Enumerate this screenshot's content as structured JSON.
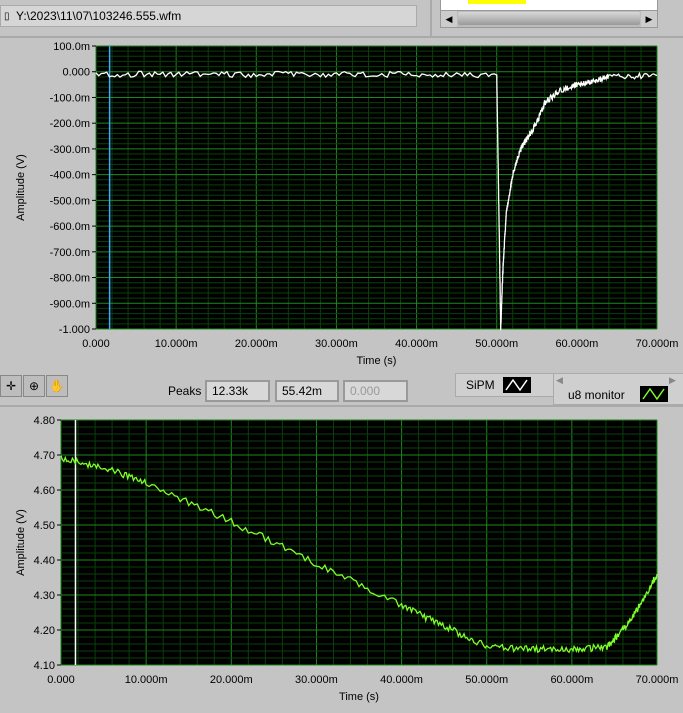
{
  "file_path": "Y:\\2023\\11\\07\\103246.555.wfm",
  "toolbar": {
    "cursor_tool": "cursor-move-icon",
    "zoom_tool": "zoom-icon",
    "pan_tool": "hand-icon"
  },
  "peaks": {
    "label": "Peaks",
    "values": [
      "12.33k",
      "55.42m",
      "0.000"
    ]
  },
  "legend": {
    "sipm": "SiPM",
    "u8": "u8 monitor"
  },
  "colors": {
    "plot_bg": "#000000",
    "grid": "#117711",
    "trace_top": "#ffffff",
    "trace_bottom": "#7dff2a"
  },
  "chart_data": [
    {
      "type": "line",
      "xlabel": "Time (s)",
      "ylabel": "Amplitude (V)",
      "xlim": [
        0,
        0.07
      ],
      "ylim": [
        -1.0,
        0.1
      ],
      "xticks": [
        "0.000",
        "10.000m",
        "20.000m",
        "30.000m",
        "40.000m",
        "50.000m",
        "60.000m",
        "70.000m"
      ],
      "yticks": [
        "100.0m",
        "0.000",
        "-100.0m",
        "-200.0m",
        "-300.0m",
        "-400.0m",
        "-500.0m",
        "-600.0m",
        "-700.0m",
        "-800.0m",
        "-900.0m",
        "-1.000"
      ],
      "grid": true,
      "cursor_x": 0.0017,
      "series": [
        {
          "name": "SiPM",
          "x": [
            0,
            0.01,
            0.02,
            0.03,
            0.04,
            0.05,
            0.0502,
            0.0505,
            0.0508,
            0.0512,
            0.052,
            0.053,
            0.054,
            0.055,
            0.056,
            0.058,
            0.06,
            0.062,
            0.064,
            0.07
          ],
          "y": [
            -0.01,
            -0.01,
            -0.01,
            -0.01,
            -0.01,
            -0.012,
            -0.4,
            -1.0,
            -0.75,
            -0.55,
            -0.4,
            -0.3,
            -0.25,
            -0.2,
            -0.12,
            -0.07,
            -0.05,
            -0.04,
            -0.02,
            -0.015
          ]
        }
      ]
    },
    {
      "type": "line",
      "xlabel": "Time (s)",
      "ylabel": "Amplitude (V)",
      "xlim": [
        0,
        0.07
      ],
      "ylim": [
        4.1,
        4.8
      ],
      "xticks": [
        "0.000",
        "10.000m",
        "20.000m",
        "30.000m",
        "40.000m",
        "50.000m",
        "60.000m",
        "70.000m"
      ],
      "yticks": [
        "4.80",
        "4.70",
        "4.60",
        "4.50",
        "4.40",
        "4.30",
        "4.20",
        "4.10"
      ],
      "grid": true,
      "cursor_x": 0.0017,
      "series": [
        {
          "name": "u8 monitor",
          "x": [
            0,
            0.005,
            0.01,
            0.02,
            0.03,
            0.04,
            0.045,
            0.05,
            0.055,
            0.06,
            0.064,
            0.066,
            0.068,
            0.07
          ],
          "y": [
            4.69,
            4.665,
            4.62,
            4.51,
            4.39,
            4.27,
            4.21,
            4.155,
            4.145,
            4.145,
            4.15,
            4.2,
            4.27,
            4.36
          ]
        }
      ]
    }
  ]
}
